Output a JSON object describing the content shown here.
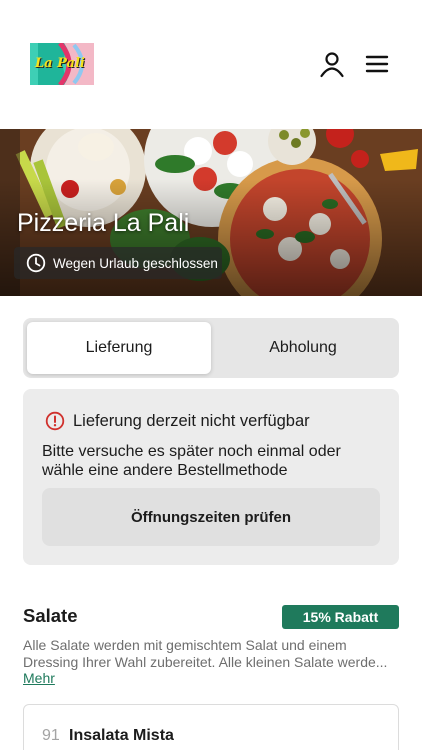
{
  "header": {
    "logo_text": "La Pali",
    "icons": {
      "account": "user-icon",
      "menu": "hamburger-menu-icon"
    }
  },
  "hero": {
    "title": "Pizzeria La Pali",
    "status_text": "Wegen Urlaub geschlossen",
    "status_icon": "clock-icon"
  },
  "order_mode": {
    "options": [
      {
        "label": "Lieferung",
        "selected": true
      },
      {
        "label": "Abholung",
        "selected": false
      }
    ]
  },
  "notice": {
    "icon": "alert-circle-icon",
    "title": "Lieferung derzeit nicht verfügbar",
    "body_line1": "Bitte versuche es später noch einmal oder",
    "body_line2": "wähle eine andere Bestellmethode",
    "button_label": "Öffnungszeiten prüfen"
  },
  "category": {
    "title": "Salate",
    "badge": "15% Rabatt",
    "description_line1": "Alle Salate werden mit gemischtem Salat und einem",
    "description_line2": "Dressing Ihrer Wahl zubereitet. Alle kleinen Salate werde...",
    "more_link": "Mehr"
  },
  "items": [
    {
      "number": "91",
      "name": "Insalata Mista"
    }
  ],
  "colors": {
    "accent_green": "#1f7a5c",
    "alert_red": "#d0312d",
    "card_gray": "#ececec"
  }
}
